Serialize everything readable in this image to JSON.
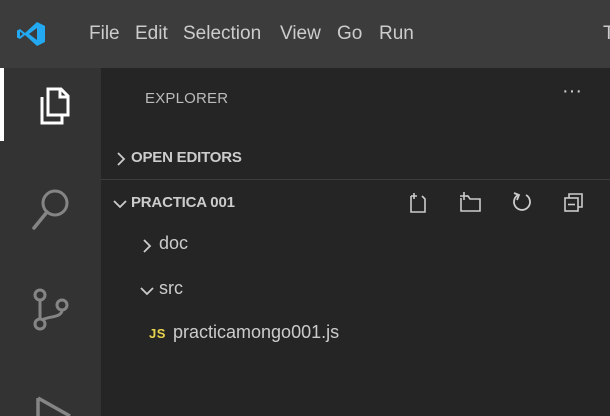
{
  "menu": {
    "items": [
      "File",
      "Edit",
      "Selection",
      "View",
      "Go",
      "Run",
      "T"
    ]
  },
  "activity_bar": {
    "icons": [
      "explorer-icon",
      "search-icon",
      "source-control-icon",
      "run-icon"
    ]
  },
  "sidebar": {
    "title": "EXPLORER",
    "more_label": "···",
    "open_editors": {
      "label": "OPEN EDITORS",
      "expanded": false
    },
    "workspace": {
      "label": "PRACTICA 001",
      "expanded": true,
      "actions": [
        "new-file-icon",
        "new-folder-icon",
        "refresh-icon",
        "collapse-all-icon"
      ]
    },
    "tree": [
      {
        "label": "doc",
        "type": "folder",
        "expanded": false
      },
      {
        "label": "src",
        "type": "folder",
        "expanded": true
      },
      {
        "label": "practicamongo001.js",
        "type": "file",
        "badge": "JS"
      }
    ]
  },
  "colors": {
    "title_bar": "#3c3c3c",
    "activity_bar": "#333333",
    "sidebar": "#252526",
    "vscode_blue": "#23a9f2",
    "js_yellow": "#e8d44d"
  }
}
